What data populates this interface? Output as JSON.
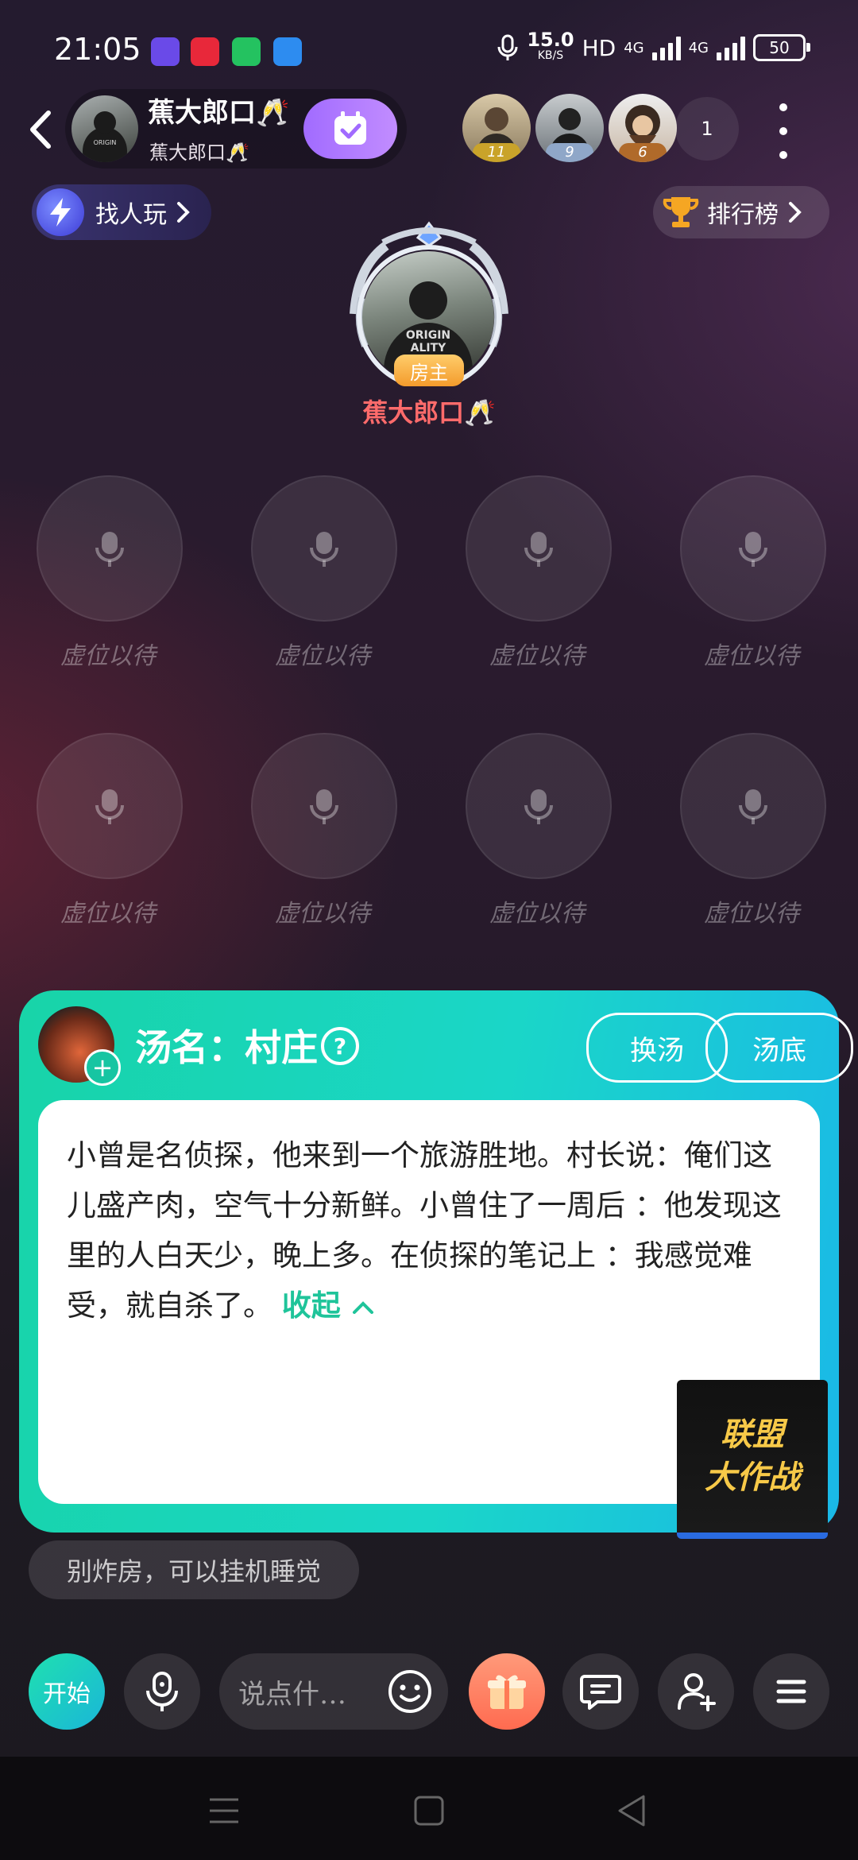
{
  "status_bar": {
    "time": "21:05",
    "net_speed": "15.0",
    "net_unit": "KB/S",
    "hd": "HD",
    "sig1": "4G",
    "sig2": "4G",
    "battery": "50"
  },
  "header": {
    "room_name": "蕉大郎口🥂",
    "room_sub": "蕉大郎口🥂",
    "top_users": [
      {
        "rank": "11",
        "rank_color": "#c9a32a"
      },
      {
        "rank": "9",
        "rank_color": "#8fa7c8"
      },
      {
        "rank": "6",
        "rank_color": "#b06a2a"
      }
    ],
    "audience_count": "1"
  },
  "find_players": {
    "label": "找人玩"
  },
  "leaderboard": {
    "label": "排行榜"
  },
  "host": {
    "badge": "房主",
    "name": "蕉大郎口🥂"
  },
  "seats": [
    {
      "label": "虚位以待"
    },
    {
      "label": "虚位以待"
    },
    {
      "label": "虚位以待"
    },
    {
      "label": "虚位以待"
    },
    {
      "label": "虚位以待"
    },
    {
      "label": "虚位以待"
    },
    {
      "label": "虚位以待"
    },
    {
      "label": "虚位以待"
    }
  ],
  "soup": {
    "title": "汤名：村庄",
    "swap_label": "换汤",
    "answer_label": "汤底",
    "story": "小曾是名侦探，他来到一个旅游胜地。村长说：俺们这儿盛产肉，空气十分新鲜。小曾住了一周后 ：他发现这里的人白天少，晚上多。在侦探的笔记上 ：我感觉难受，就自杀了。",
    "collapse_label": "收起",
    "promo_line1": "联盟",
    "promo_line2": "大作战"
  },
  "tip": "别炸房，可以挂机睡觉",
  "bottom_bar": {
    "start_label": "开始",
    "chat_placeholder": "说点什…"
  },
  "colors": {
    "accent": "#1ad6c8",
    "purple": "#a16bff",
    "host_name": "#ff6b6b"
  }
}
